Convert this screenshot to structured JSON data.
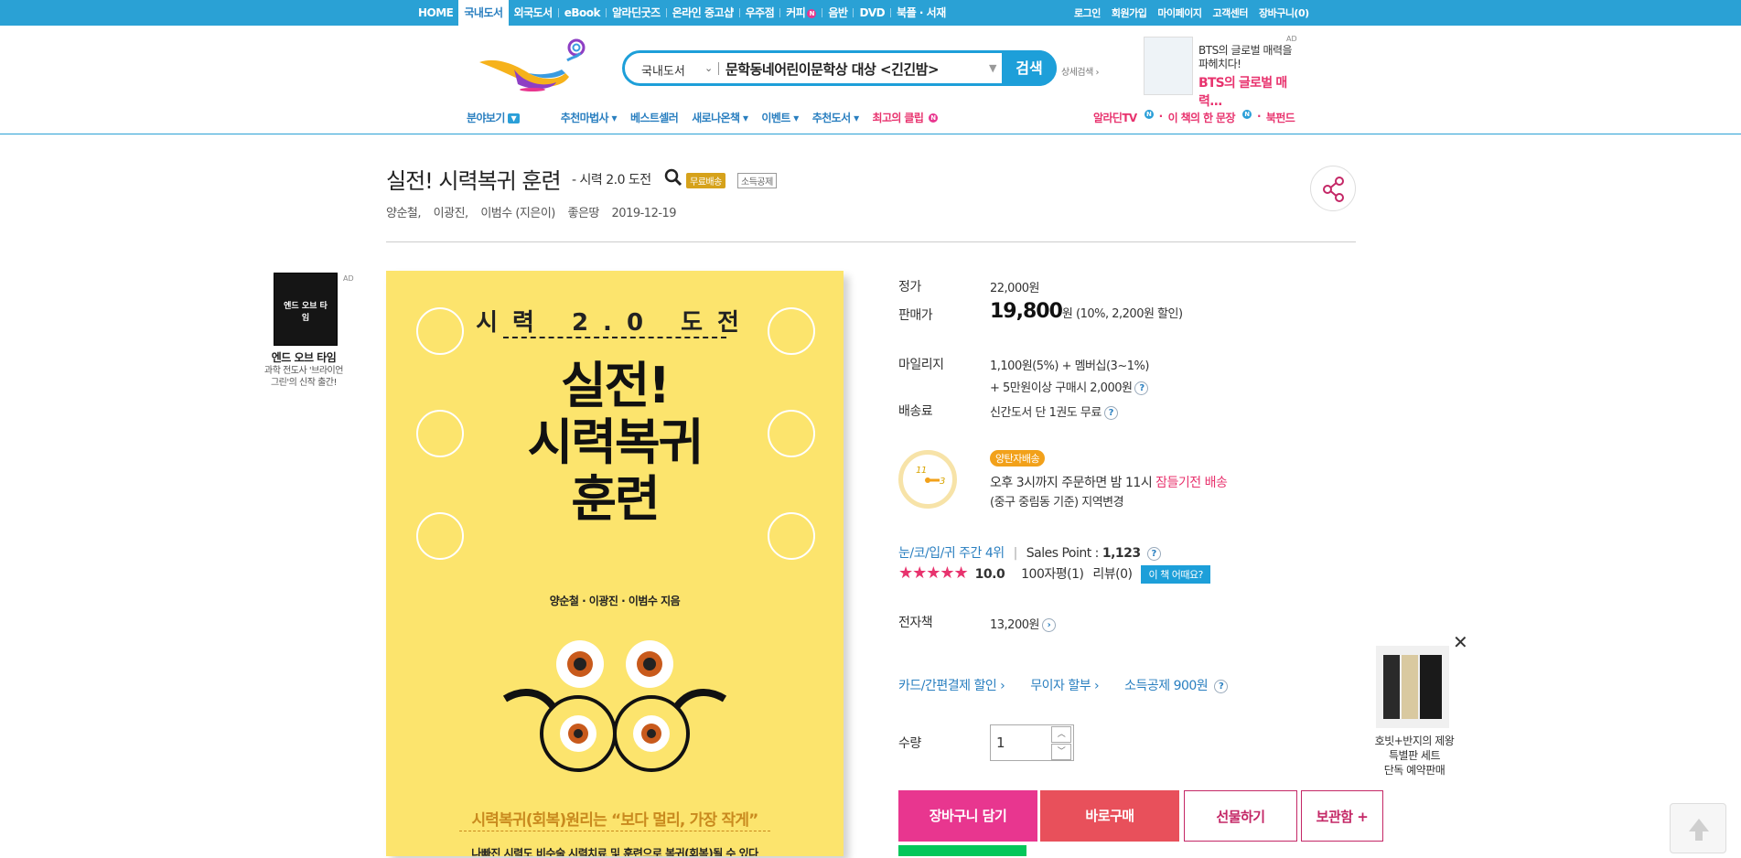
{
  "topnav": {
    "items": [
      "HOME",
      "국내도서",
      "외국도서",
      "eBook",
      "알라딘굿즈",
      "온라인 중고샵",
      "우주점",
      "커피",
      "음반",
      "DVD",
      "북플 · 서재"
    ],
    "coffee_badge": "N",
    "right": [
      "로그인",
      "회원가입",
      "마이페이지",
      "고객센터",
      "장바구니(0)"
    ]
  },
  "search": {
    "category": "국내도서",
    "query": "문학동네어린이문학상 대상 <긴긴밤>",
    "button": "검색",
    "detail": "상세검색"
  },
  "top_ad": {
    "label": "AD",
    "line1": "BTS의 글로벌 매력을",
    "line2": "파헤치다!",
    "line3": "BTS의 글로벌 매력..."
  },
  "subnav": {
    "items": [
      "분야보기",
      "추천마법사",
      "베스트셀러",
      "새로나온책",
      "이벤트",
      "추천도서",
      "최고의 클립"
    ],
    "clip_badge": "N",
    "right": [
      "알라딘TV",
      "이 책의 한 문장",
      "북펀드"
    ]
  },
  "book": {
    "title": "실전! 시력복귀 훈련",
    "subtitle": "- 시력 2.0 도전",
    "tag_free": "무료배송",
    "tag_deduct": "소득공제",
    "authors": [
      "양순철,",
      "이광진,",
      "이범수 (지은이)",
      "좋은땅",
      "2019-12-19"
    ]
  },
  "cover": {
    "top": "시력 2.0 도전",
    "big1": "실전!",
    "big2": "시력복귀",
    "big3": "훈련",
    "authors": "양순철 · 이광진 · 이범수 지음",
    "tagline": "시력복귀(회복)원리는 “보다 멀리, 가장 작게”",
    "line2": "나빠진 시력도 비수술 시력치료 및 훈련으로 복귀(회복)될 수 있다"
  },
  "left_ad": {
    "label": "AD",
    "title": "엔드 오브 타임",
    "sub1": "과학 전도사 '브라이언",
    "sub2": "그린'의 신작 출간!"
  },
  "info": {
    "list_price_label": "정가",
    "list_price": "22,000원",
    "sale_label": "판매가",
    "sale_price": "19,800",
    "sale_unit": "원",
    "sale_detail": "(10%, 2,200원 할인)",
    "mileage_label": "마일리지",
    "mileage1": "1,100원(5%) + 멤버십(3~1%)",
    "mileage2": "+ 5만원이상 구매시 2,000원",
    "ship_label": "배송료",
    "ship": "신간도서 단 1권도 무료",
    "yangtan": "양탄자배송",
    "delivery1": "오후 3시까지 주문하면 밤 11시",
    "delivery_pink": "잠들기전 배송",
    "delivery2": "(중구 중림동 기준) 지역변경",
    "rank": "눈/코/입/귀 주간 4위",
    "sales_point_label": "Sales Point :",
    "sales_point": "1,123",
    "rating": "10.0",
    "rating_stars": 5,
    "reviews100": "100자평(1)",
    "reviews": "리뷰(0)",
    "how": "이 책 어때요?",
    "ebook_label": "전자책",
    "ebook_price": "13,200원",
    "card_disc": "카드/간편결제 할인",
    "installment": "무이자 할부",
    "deduct": "소득공제 900원",
    "qty_label": "수량",
    "qty": "1"
  },
  "buttons": {
    "cart": "장바구니 담기",
    "buy": "바로구매",
    "gift": "선물하기",
    "keep": "보관함 +"
  },
  "right_ad": {
    "line1": "호빗+반지의 제왕",
    "line2": "특별판 세트",
    "line3": "단독 예약판매"
  },
  "colors": {
    "brand_blue": "#2aa1d5",
    "pink": "#e8368f",
    "red": "#e8505b",
    "cover_yellow": "#fce46d"
  }
}
